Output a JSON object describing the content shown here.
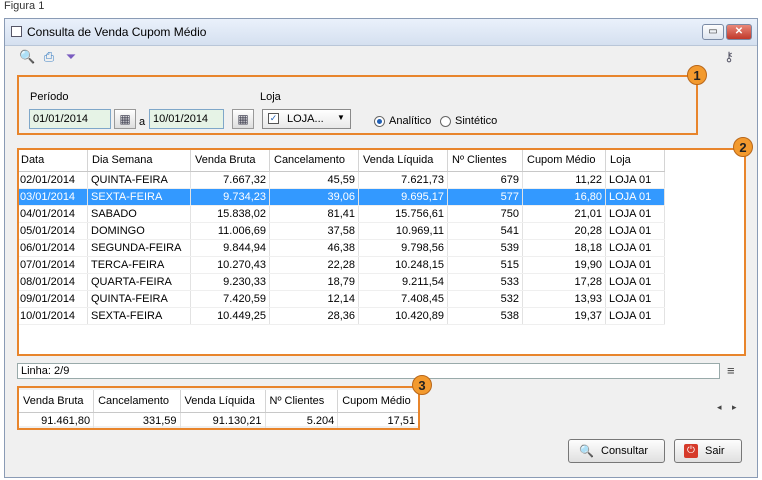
{
  "caption": "Figura 1",
  "window": {
    "title": "Consulta de Venda Cupom Médio"
  },
  "filters": {
    "periodo_label": "Período",
    "date_from": "01/01/2014",
    "sep": "a",
    "date_to": "10/01/2014",
    "loja_label": "Loja",
    "loja_value": "LOJA...",
    "analitico": "Analítico",
    "sintetico": "Sintético"
  },
  "badges": [
    "1",
    "2",
    "3"
  ],
  "grid": {
    "columns": [
      "Data",
      "Dia Semana",
      "Venda Bruta",
      "Cancelamento",
      "Venda Líquida",
      "Nº Clientes",
      "Cupom Médio",
      "Loja"
    ],
    "rows": [
      [
        "02/01/2014",
        "QUINTA-FEIRA",
        "7.667,32",
        "45,59",
        "7.621,73",
        "679",
        "11,22",
        "LOJA 01"
      ],
      [
        "03/01/2014",
        "SEXTA-FEIRA",
        "9.734,23",
        "39,06",
        "9.695,17",
        "577",
        "16,80",
        "LOJA 01"
      ],
      [
        "04/01/2014",
        "SABADO",
        "15.838,02",
        "81,41",
        "15.756,61",
        "750",
        "21,01",
        "LOJA 01"
      ],
      [
        "05/01/2014",
        "DOMINGO",
        "11.006,69",
        "37,58",
        "10.969,11",
        "541",
        "20,28",
        "LOJA 01"
      ],
      [
        "06/01/2014",
        "SEGUNDA-FEIRA",
        "9.844,94",
        "46,38",
        "9.798,56",
        "539",
        "18,18",
        "LOJA 01"
      ],
      [
        "07/01/2014",
        "TERCA-FEIRA",
        "10.270,43",
        "22,28",
        "10.248,15",
        "515",
        "19,90",
        "LOJA 01"
      ],
      [
        "08/01/2014",
        "QUARTA-FEIRA",
        "9.230,33",
        "18,79",
        "9.211,54",
        "533",
        "17,28",
        "LOJA 01"
      ],
      [
        "09/01/2014",
        "QUINTA-FEIRA",
        "7.420,59",
        "12,14",
        "7.408,45",
        "532",
        "13,93",
        "LOJA 01"
      ],
      [
        "10/01/2014",
        "SEXTA-FEIRA",
        "10.449,25",
        "28,36",
        "10.420,89",
        "538",
        "19,37",
        "LOJA 01"
      ]
    ],
    "selected_row": 1
  },
  "status": {
    "line": "Linha: 2/9"
  },
  "totals": {
    "columns": [
      "Venda Bruta",
      "Cancelamento",
      "Venda Líquida",
      "Nº Clientes",
      "Cupom Médio"
    ],
    "values": [
      "91.461,80",
      "331,59",
      "91.130,21",
      "5.204",
      "17,51"
    ]
  },
  "buttons": {
    "consultar": "Consultar",
    "sair": "Sair"
  },
  "colors": {
    "highlight": "#e8852c",
    "selection": "#3399ff",
    "date_field": "#e6f3e6"
  }
}
